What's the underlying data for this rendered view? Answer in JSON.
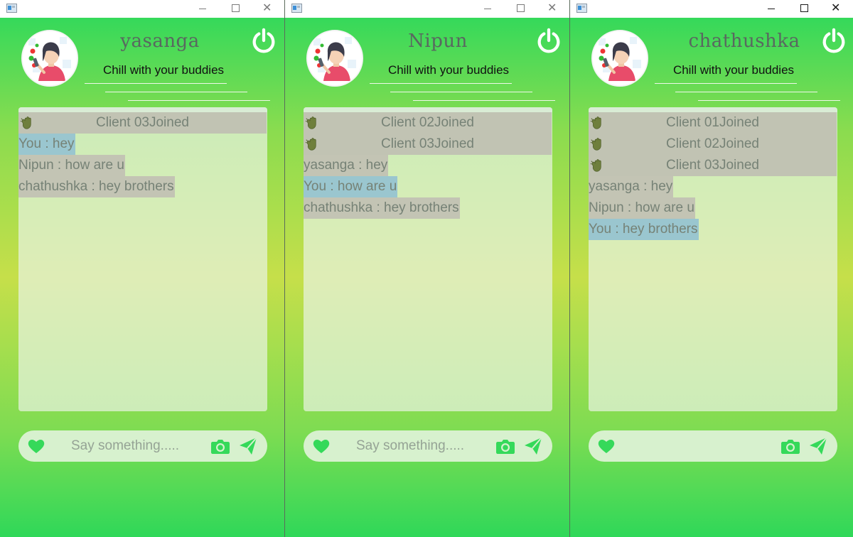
{
  "colors": {
    "accent_green": "#2fd859",
    "join_bg": "#c1c3b3",
    "self_msg_bg": "#9ac6cf",
    "other_msg_bg": "#c3c4b4",
    "text_gray": "#768276",
    "input_bg": "#d7f1ce"
  },
  "icons": {
    "app": "app-window-icon",
    "minimize": "minimize-icon",
    "maximize": "maximize-icon",
    "close": "close-icon",
    "power": "power-icon",
    "wave": "waving-hand-icon",
    "heart": "heart-icon",
    "camera": "camera-icon",
    "send": "send-icon"
  },
  "windows": [
    {
      "username": "yasanga",
      "tagline": "Chill with your buddies",
      "title_bar": {
        "close_glyph": "✕"
      },
      "joins": [
        "Client 03Joined"
      ],
      "messages": [
        {
          "text": "You : hey",
          "kind": "mine"
        },
        {
          "text": "Nipun : how are u",
          "kind": "other"
        },
        {
          "text": "chathushka : hey brothers",
          "kind": "other"
        }
      ],
      "input": {
        "placeholder": "Say something.....",
        "value": ""
      }
    },
    {
      "username": "Nipun",
      "tagline": "Chill with your buddies",
      "title_bar": {
        "close_glyph": "✕"
      },
      "joins": [
        "Client 02Joined",
        "Client 03Joined"
      ],
      "messages": [
        {
          "text": "yasanga : hey",
          "kind": "other"
        },
        {
          "text": "You : how are u",
          "kind": "mine"
        },
        {
          "text": "chathushka : hey brothers",
          "kind": "other"
        }
      ],
      "input": {
        "placeholder": "Say something.....",
        "value": ""
      }
    },
    {
      "username": "chathushka",
      "tagline": "Chill with your buddies",
      "title_bar": {
        "close_glyph": "✕"
      },
      "joins": [
        "Client 01Joined",
        "Client 02Joined",
        "Client 03Joined"
      ],
      "messages": [
        {
          "text": "yasanga : hey",
          "kind": "other"
        },
        {
          "text": "Nipun : how are u",
          "kind": "other"
        },
        {
          "text": "You : hey brothers",
          "kind": "mine"
        }
      ],
      "input": {
        "placeholder": "",
        "value": ""
      }
    }
  ]
}
